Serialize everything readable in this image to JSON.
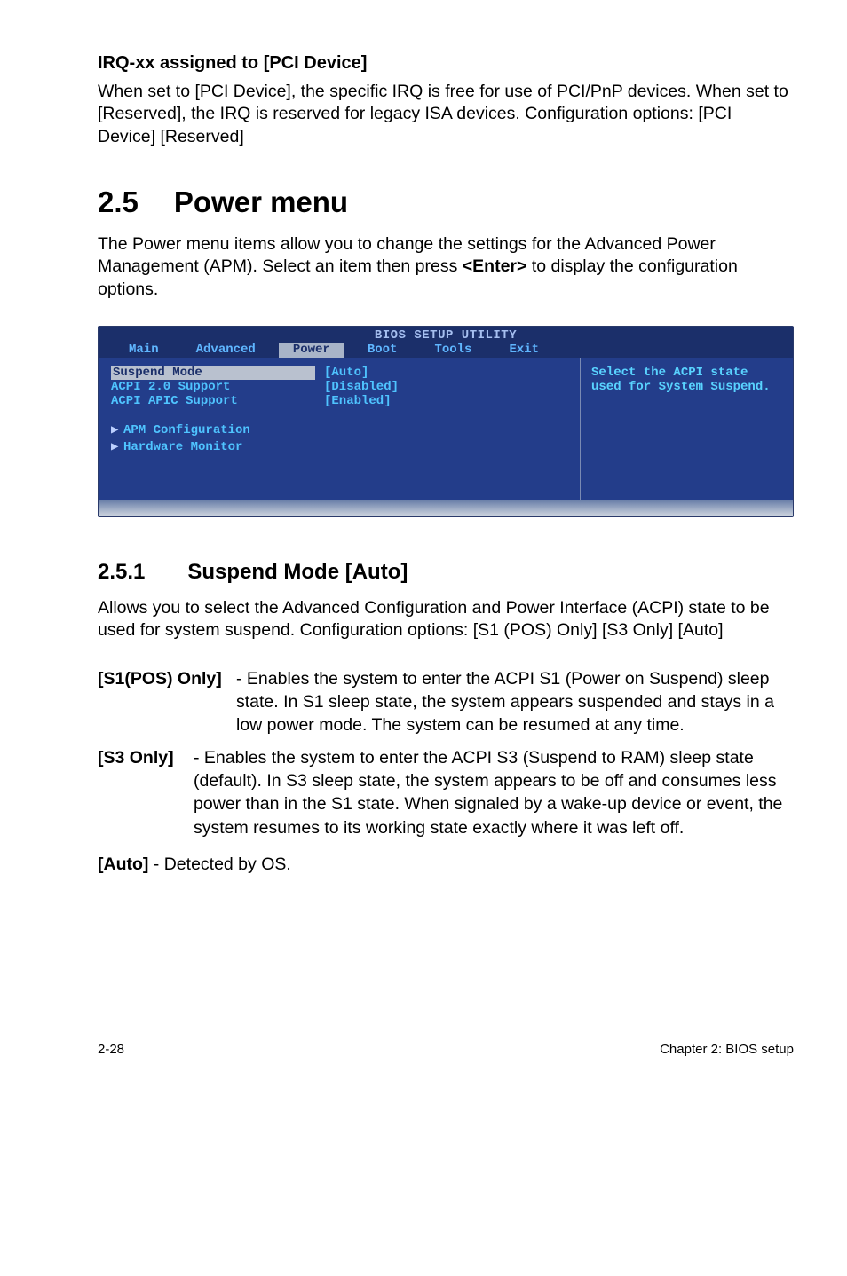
{
  "sec1": {
    "heading": "IRQ-xx assigned to [PCI Device]",
    "para": "When set to [PCI Device], the specific IRQ is free for use of PCI/PnP devices. When set to [Reserved], the IRQ is reserved for legacy ISA devices. Configuration options: [PCI Device] [Reserved]"
  },
  "section": {
    "num": "2.5",
    "title": "Power menu",
    "intro_part1": "The Power menu items allow you to change the settings for the Advanced Power Management (APM). Select an item then press ",
    "intro_bold": "<Enter>",
    "intro_part2": " to display the configuration options."
  },
  "bios": {
    "utility_title": "BIOS SETUP UTILITY",
    "tabs": [
      "Main",
      "Advanced",
      "Power",
      "Boot",
      "Tools",
      "Exit"
    ],
    "active_tab_index": 2,
    "rows": [
      {
        "label": "Suspend Mode",
        "value": "[Auto]",
        "selected": true
      },
      {
        "label": "ACPI 2.0 Support",
        "value": "[Disabled]",
        "selected": false
      },
      {
        "label": "ACPI APIC Support",
        "value": "[Enabled]",
        "selected": false
      }
    ],
    "menu_items": [
      "APM Configuration",
      "Hardware Monitor"
    ],
    "help_text": "Select the ACPI state used for System Suspend."
  },
  "subsection": {
    "num": "2.5.1",
    "title": "Suspend Mode [Auto]",
    "para": "Allows you to select the Advanced Configuration and Power Interface (ACPI) state to be used for system suspend. Configuration options: [S1 (POS) Only] [S3 Only] [Auto]"
  },
  "defs": {
    "d1_term": "[S1(POS) Only]",
    "d1_text": " - Enables the system to enter the ACPI S1 (Power on Suspend) sleep state. In S1 sleep state, the system appears suspended and stays in a low power mode. The system can be resumed at any time.",
    "d2_term": "[S3 Only]",
    "d2_text": " - Enables the system to enter the ACPI S3 (Suspend to RAM) sleep state (default). In S3 sleep state, the system appears to be off and consumes less power than in the S1 state. When signaled by a wake-up device or event, the system resumes to its working state exactly where it was left off.",
    "d3_term": "[Auto]",
    "d3_text": " - Detected by OS."
  },
  "footer": {
    "left": "2-28",
    "right": "Chapter 2: BIOS setup"
  }
}
